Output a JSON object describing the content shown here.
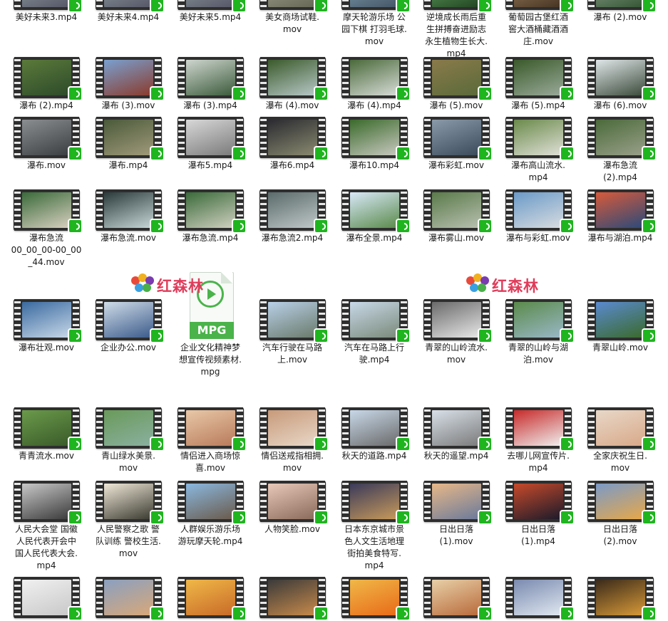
{
  "watermarks": [
    "红森林",
    "红森林"
  ],
  "mpg_badge": "MPG",
  "files": [
    {
      "name": "美好未来3.mp4",
      "colors": [
        "#9aa",
        "#556"
      ]
    },
    {
      "name": "美好未来4.mp4",
      "colors": [
        "#9aa",
        "#556"
      ]
    },
    {
      "name": "美好未来5.mp4",
      "colors": [
        "#9aa",
        "#556"
      ]
    },
    {
      "name": "美女商场试鞋.\nmov",
      "colors": [
        "#aa9",
        "#665"
      ]
    },
    {
      "name": "摩天轮游乐场 公\n园下棋 打羽毛球.\nmov",
      "colors": [
        "#8ab",
        "#456"
      ]
    },
    {
      "name": "逆境成长雨后重\n生拼搏奋进励志\n永生植物生长大.\nmp4",
      "colors": [
        "#6a6",
        "#242"
      ]
    },
    {
      "name": "葡萄园古堡红酒\n窖大酒桶藏酒酒\n庄.mov",
      "colors": [
        "#a86",
        "#432"
      ]
    },
    {
      "name": "瀑布 (2).mov",
      "colors": [
        "#9a9",
        "#353"
      ]
    },
    {
      "name": "瀑布 (2).mp4",
      "colors": [
        "#5a7a3a",
        "#2d4a2a"
      ]
    },
    {
      "name": "瀑布 (3).mov",
      "colors": [
        "#7aa0d0",
        "#8a3a2a"
      ]
    },
    {
      "name": "瀑布 (3).mp4",
      "colors": [
        "#cfd6cf",
        "#3a5a3a"
      ]
    },
    {
      "name": "瀑布 (4).mov",
      "colors": [
        "#3a5a2a",
        "#b8c8c8"
      ]
    },
    {
      "name": "瀑布 (4).mp4",
      "colors": [
        "#4a6a3a",
        "#d8dcd8"
      ]
    },
    {
      "name": "瀑布 (5).mov",
      "colors": [
        "#8a7a4a",
        "#5a6a3a"
      ]
    },
    {
      "name": "瀑布 (5).mp4",
      "colors": [
        "#3a5a2a",
        "#9aaa9a"
      ]
    },
    {
      "name": "瀑布 (6).mov",
      "colors": [
        "#e0e6e8",
        "#3a4a3a"
      ]
    },
    {
      "name": "瀑布.mov",
      "colors": [
        "#8a8e90",
        "#3a3e40"
      ]
    },
    {
      "name": "瀑布.mp4",
      "colors": [
        "#4a5a3a",
        "#a09a7a"
      ]
    },
    {
      "name": "瀑布5.mp4",
      "colors": [
        "#d8d8d8",
        "#7a7a7a"
      ]
    },
    {
      "name": "瀑布6.mp4",
      "colors": [
        "#2a2a30",
        "#8a8a70"
      ]
    },
    {
      "name": "瀑布10.mp4",
      "colors": [
        "#3a6a2a",
        "#c8c8c0"
      ]
    },
    {
      "name": "瀑布彩虹.mov",
      "colors": [
        "#8a9aaa",
        "#3a4a5a"
      ]
    },
    {
      "name": "瀑布高山流水.\nmp4",
      "colors": [
        "#6a8a4a",
        "#e0e0d8"
      ]
    },
    {
      "name": "瀑布急流\n(2).mp4",
      "colors": [
        "#4a6a3a",
        "#9aa08a"
      ]
    },
    {
      "name": "瀑布急流\n00_00_00-00_00\n_44.mov",
      "colors": [
        "#3a6a3a",
        "#d8d0c0"
      ]
    },
    {
      "name": "瀑布急流.mov",
      "colors": [
        "#2a3a3a",
        "#c8d8d8"
      ]
    },
    {
      "name": "瀑布急流.mp4",
      "colors": [
        "#3a6a3a",
        "#d0d0c0"
      ]
    },
    {
      "name": "瀑布急流2.mp4",
      "colors": [
        "#5a6a6a",
        "#c0c8c8"
      ]
    },
    {
      "name": "瀑布全景.mp4",
      "colors": [
        "#d8e8f8",
        "#5a8a4a"
      ]
    },
    {
      "name": "瀑布雾山.mov",
      "colors": [
        "#5a7a4a",
        "#b8c0b0"
      ]
    },
    {
      "name": "瀑布与彩虹.mov",
      "colors": [
        "#6a9ac8",
        "#d8dce0"
      ]
    },
    {
      "name": "瀑布与湖泊.mp4",
      "colors": [
        "#d85a3a",
        "#2a4a7a"
      ]
    },
    {
      "name": "瀑布壮观.mov",
      "colors": [
        "#3a6aa0",
        "#c8d8e8"
      ]
    },
    {
      "name": "企业办公.mov",
      "colors": [
        "#d0dce8",
        "#3a5a8a"
      ]
    },
    {
      "name": "企业文化精神梦\n想宣传视频素材.\nmpg",
      "colors": []
    },
    {
      "name": "汽车行驶在马路\n上.mov",
      "colors": [
        "#b8d0e8",
        "#6a7a6a"
      ]
    },
    {
      "name": "汽车在马路上行\n驶.mp4",
      "colors": [
        "#c8d8e8",
        "#7a8a7a"
      ]
    },
    {
      "name": "青翠的山岭流水.\nmov",
      "colors": [
        "#6a6a6a",
        "#e8e8e8"
      ]
    },
    {
      "name": "青翠的山岭与湖\n泊.mov",
      "colors": [
        "#5a8a4a",
        "#9ab8c8"
      ]
    },
    {
      "name": "青翠山岭.mov",
      "colors": [
        "#5a8ad0",
        "#3a6a2a"
      ]
    },
    {
      "name": "青青流水.mov",
      "colors": [
        "#6a9a4a",
        "#3a5a2a"
      ]
    },
    {
      "name": "青山绿水美景.\nmov",
      "colors": [
        "#6a9a5a",
        "#8ab0a0"
      ]
    },
    {
      "name": "情侣进入商场惊\n喜.mov",
      "colors": [
        "#e8c8a8",
        "#b87a5a"
      ]
    },
    {
      "name": "情侣送戒指相拥.\nmov",
      "colors": [
        "#c89a7a",
        "#e8d8c8"
      ]
    },
    {
      "name": "秋天的道路.mp4",
      "colors": [
        "#c8d8e8",
        "#6a6a6a"
      ]
    },
    {
      "name": "秋天的遥望.mp4",
      "colors": [
        "#d8e0e8",
        "#7a7a7a"
      ]
    },
    {
      "name": "去哪儿网宣传片.\nmp4",
      "colors": [
        "#c82a2a",
        "#f0f0f0"
      ]
    },
    {
      "name": "全家庆祝生日.\nmov",
      "colors": [
        "#e8d8c8",
        "#d8a888"
      ]
    },
    {
      "name": "人民大会堂 国徽\n人民代表开会中\n国人民代表大会.\nmp4",
      "colors": [
        "#c8c8c8",
        "#3a3a3a"
      ]
    },
    {
      "name": "人民警察之歌 警\n队训练 警校生活.\nmov",
      "colors": [
        "#f0e8d8",
        "#3a3a30"
      ]
    },
    {
      "name": "人群娱乐游乐场\n游玩摩天轮.mp4",
      "colors": [
        "#8ab8e0",
        "#6a5a4a"
      ]
    },
    {
      "name": "人物笑脸.mov",
      "colors": [
        "#e8c8b8",
        "#8a6a5a"
      ]
    },
    {
      "name": "日本东京城市景\n色人文生活地理\n街拍美食特写.\nmp4",
      "colors": [
        "#3a3a5a",
        "#c89a5a"
      ]
    },
    {
      "name": "日出日落\n(1).mov",
      "colors": [
        "#e8b888",
        "#6a7a9a"
      ]
    },
    {
      "name": "日出日落\n(1).mp4",
      "colors": [
        "#c84a2a",
        "#1a1a2a"
      ]
    },
    {
      "name": "日出日落\n(2).mov",
      "colors": [
        "#7a9ac8",
        "#e8a848"
      ]
    },
    {
      "name": "",
      "colors": [
        "#f0f0f0",
        "#c8c8c8"
      ]
    },
    {
      "name": "",
      "colors": [
        "#8aa0c0",
        "#d8a878"
      ]
    },
    {
      "name": "",
      "colors": [
        "#f0b848",
        "#c86a28"
      ]
    },
    {
      "name": "",
      "colors": [
        "#3a3a3a",
        "#c88a4a"
      ]
    },
    {
      "name": "",
      "colors": [
        "#f0b848",
        "#e86a18"
      ]
    },
    {
      "name": "",
      "colors": [
        "#e8d0a8",
        "#b86a3a"
      ]
    },
    {
      "name": "",
      "colors": [
        "#7a8ab0",
        "#e0e8f0"
      ]
    },
    {
      "name": "",
      "colors": [
        "#3a2a1a",
        "#d89a38"
      ]
    }
  ]
}
